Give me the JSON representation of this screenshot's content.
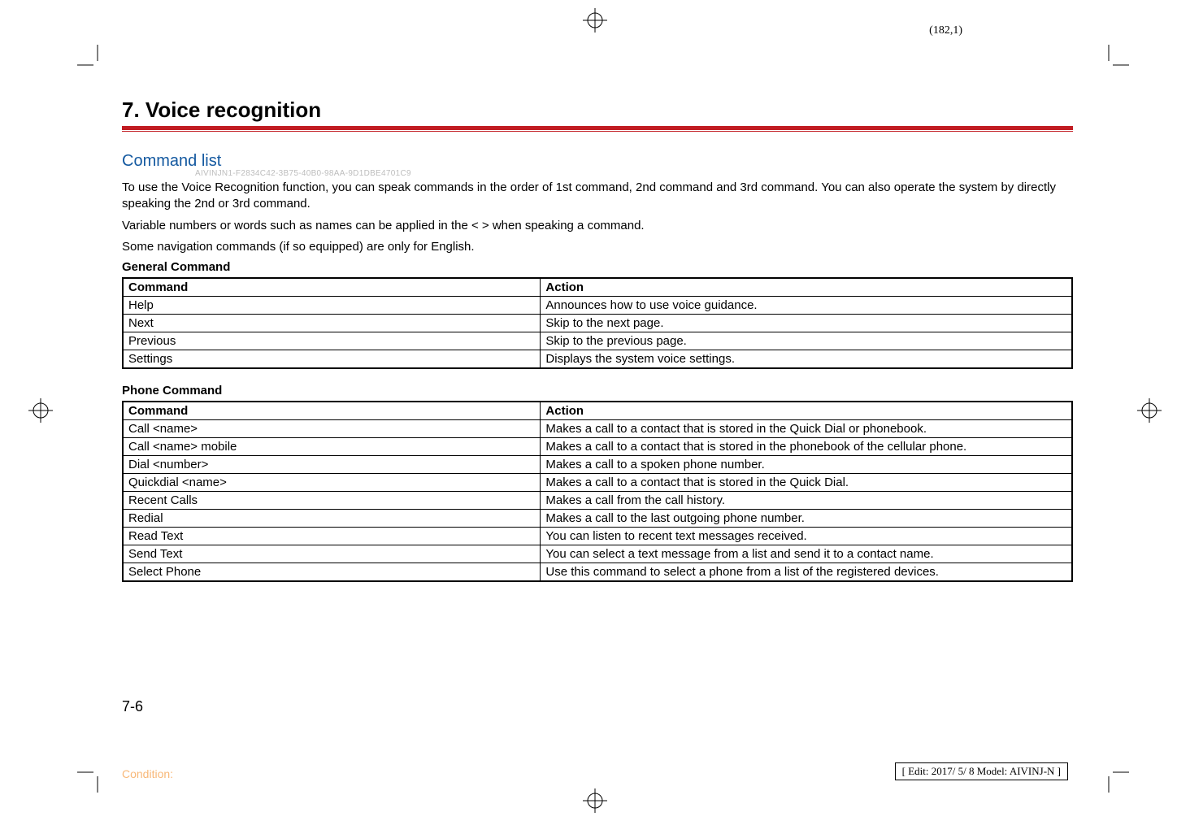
{
  "page_coord": "(182,1)",
  "chapter_title": "7. Voice recognition",
  "section_title": "Command list",
  "doc_id": "AIVINJN1-F2834C42-3B75-40B0-98AA-9D1DBE4701C9",
  "paras": {
    "p1": "To use the Voice Recognition function, you can speak commands in the order of 1st command, 2nd command and 3rd command. You can also operate the system by directly speaking the 2nd or 3rd command.",
    "p2": "Variable numbers or words such as names can be applied in the < > when speaking a command.",
    "p3": "Some navigation commands (if so equipped) are only for English."
  },
  "general_heading": "General Command",
  "general_table": {
    "headers": [
      "Command",
      "Action"
    ],
    "rows": [
      [
        "Help",
        "Announces how to use voice guidance."
      ],
      [
        "Next",
        "Skip to the next page."
      ],
      [
        "Previous",
        "Skip to the previous page."
      ],
      [
        "Settings",
        "Displays the system voice settings."
      ]
    ]
  },
  "phone_heading": "Phone Command",
  "phone_table": {
    "headers": [
      "Command",
      "Action"
    ],
    "rows": [
      [
        "Call <name>",
        "Makes a call to a contact that is stored in the Quick Dial or phonebook."
      ],
      [
        "Call <name> mobile",
        "Makes a call to a contact that is stored in the phonebook of the cellular phone."
      ],
      [
        "Dial <number>",
        "Makes a call to a spoken phone number."
      ],
      [
        "Quickdial <name>",
        "Makes a call to a contact that is stored in the Quick Dial."
      ],
      [
        "Recent Calls",
        "Makes a call from the call history."
      ],
      [
        "Redial",
        "Makes a call to the last outgoing phone number."
      ],
      [
        "Read Text",
        "You can listen to recent text messages received."
      ],
      [
        "Send Text",
        "You can select a text message from a list and send it to a contact name."
      ],
      [
        "Select Phone",
        "Use this command to select a phone from a list of the registered devices."
      ]
    ]
  },
  "page_num": "7-6",
  "condition_label": "Condition:",
  "edit_info": "[ Edit: 2017/ 5/ 8   Model: AIVINJ-N ]"
}
